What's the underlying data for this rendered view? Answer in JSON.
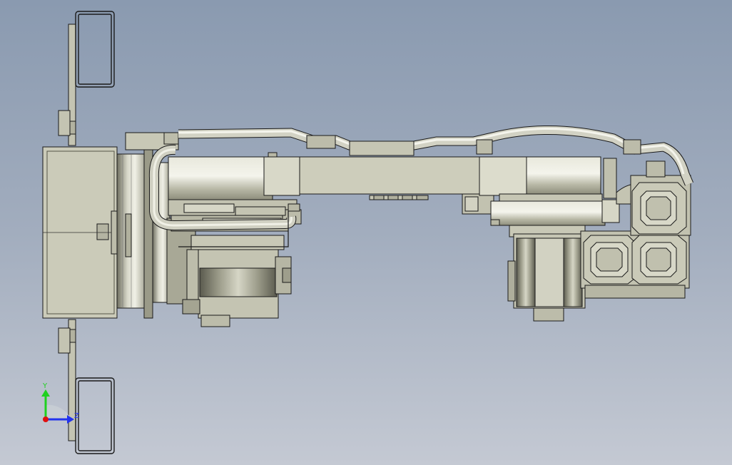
{
  "view": {
    "background_top": "#8a9ab0",
    "background_bottom": "#c4c9d3",
    "outline_color": "#1a1a1a",
    "part_fill": "#c8c8b6"
  },
  "triad": {
    "y_label": "Y",
    "z_label": "Z",
    "y_color": "#1fd11f",
    "z_color": "#2233ee",
    "origin_color": "#e01010"
  }
}
